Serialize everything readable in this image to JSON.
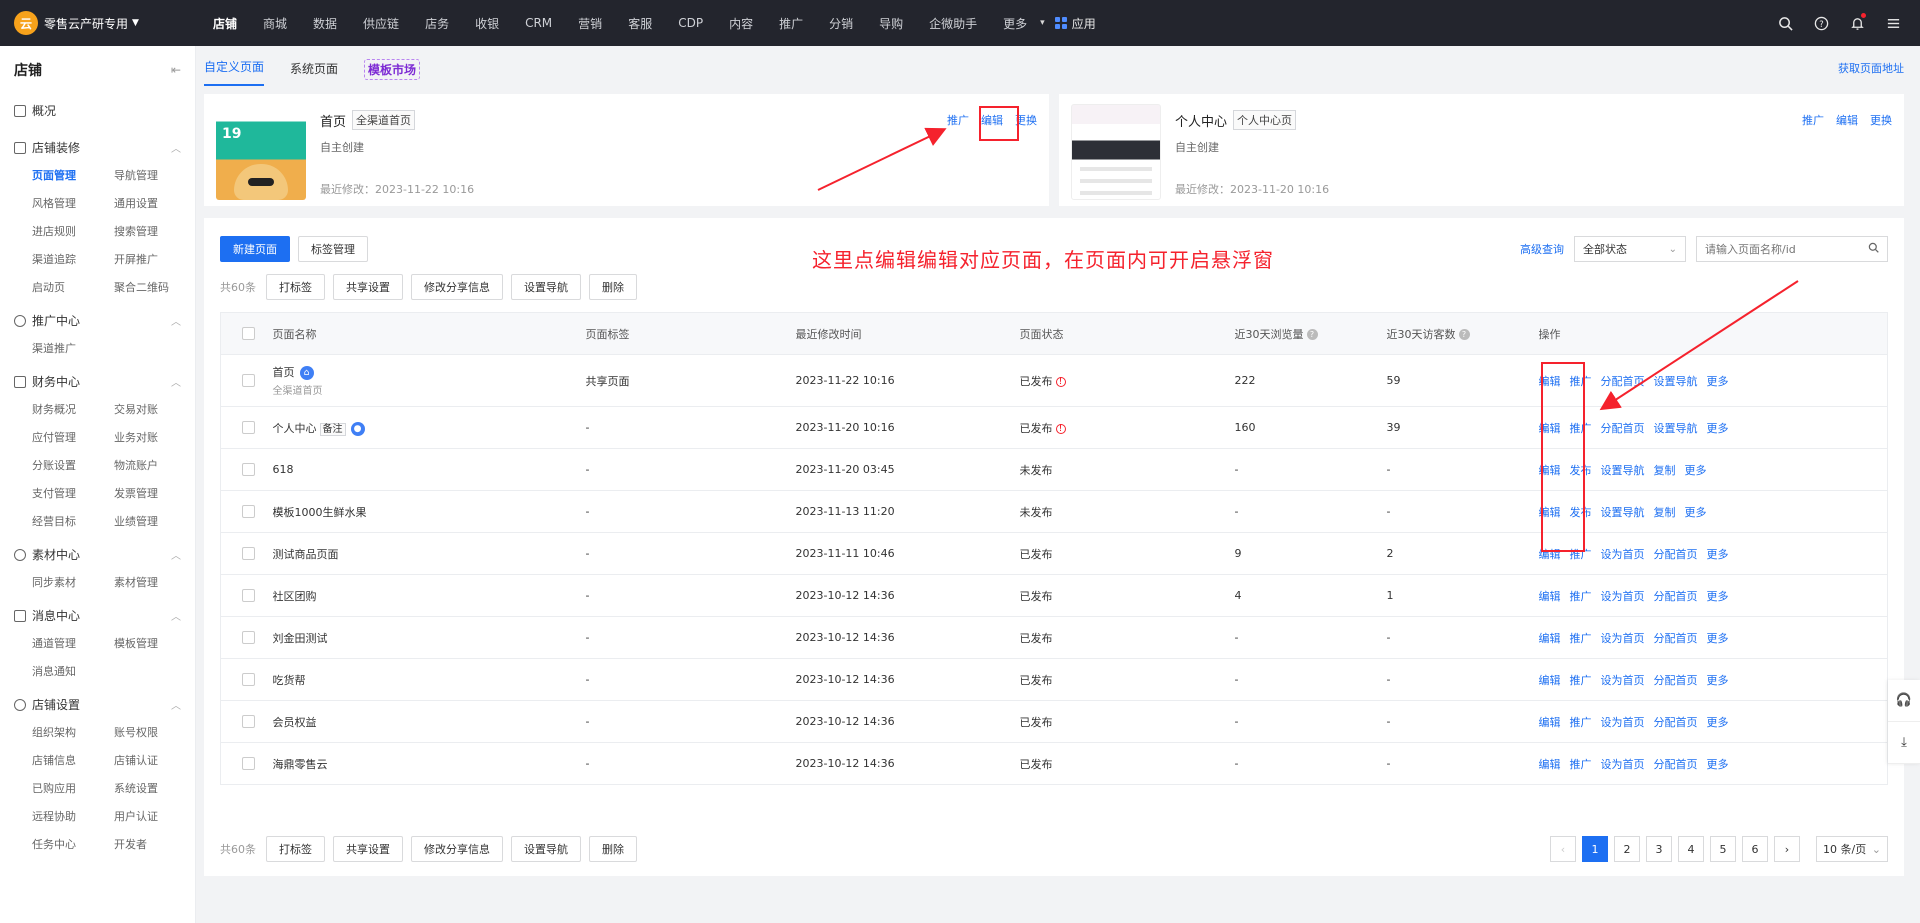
{
  "brand": {
    "name": "零售云产研专用"
  },
  "nav": {
    "items": [
      "店铺",
      "商城",
      "数据",
      "供应链",
      "店务",
      "收银",
      "CRM",
      "营销",
      "客服",
      "CDP",
      "内容",
      "推广",
      "分销",
      "导购",
      "企微助手",
      "更多"
    ],
    "app_label": "应用"
  },
  "sidebar": {
    "title": "店铺",
    "overview": "概况",
    "groups": [
      {
        "title": "店铺装修",
        "items": [
          "页面管理",
          "导航管理",
          "风格管理",
          "通用设置",
          "进店规则",
          "搜索管理",
          "渠道追踪",
          "开屏推广",
          "启动页",
          "聚合二维码"
        ]
      },
      {
        "title": "推广中心",
        "items": [
          "渠道推广"
        ]
      },
      {
        "title": "财务中心",
        "items": [
          "财务概况",
          "交易对账",
          "应付管理",
          "业务对账",
          "分账设置",
          "物流账户",
          "支付管理",
          "发票管理",
          "经营目标",
          "业绩管理"
        ]
      },
      {
        "title": "素材中心",
        "items": [
          "同步素材",
          "素材管理"
        ]
      },
      {
        "title": "消息中心",
        "items": [
          "通道管理",
          "模板管理",
          "消息通知"
        ]
      },
      {
        "title": "店铺设置",
        "items": [
          "组织架构",
          "账号权限",
          "店铺信息",
          "店铺认证",
          "已购应用",
          "系统设置",
          "远程协助",
          "用户认证",
          "任务中心",
          "开发者"
        ]
      }
    ]
  },
  "tabs": {
    "custom": "自定义页面",
    "system": "系统页面",
    "market": "模板市场",
    "get_url": "获取页面地址"
  },
  "cards": [
    {
      "title": "首页",
      "tag": "全渠道首页",
      "sub": "自主创建",
      "meta": "最近修改：2023-11-22 10:16",
      "actions": [
        "推广",
        "编辑",
        "更换"
      ]
    },
    {
      "title": "个人中心",
      "tag": "个人中心页",
      "sub": "自主创建",
      "meta": "最近修改：2023-11-20 10:16",
      "actions": [
        "推广",
        "编辑",
        "更换"
      ]
    }
  ],
  "toolbar": {
    "new_page": "新建页面",
    "tag_manage": "标签管理",
    "annotation": "这里点编辑编辑对应页面，在页面内可开启悬浮窗",
    "advanced": "高级查询",
    "status_select": "全部状态",
    "search_placeholder": "请输入页面名称/id"
  },
  "batch": {
    "count": "共60条",
    "buttons": [
      "打标签",
      "共享设置",
      "修改分享信息",
      "设置导航",
      "删除"
    ]
  },
  "table": {
    "headers": [
      "页面名称",
      "页面标签",
      "最近修改时间",
      "页面状态",
      "近30天浏览量",
      "近30天访客数",
      "操作"
    ],
    "rows": [
      {
        "name": "首页",
        "sub": "全渠道首页",
        "tag": "共享页面",
        "time": "2023-11-22 10:16",
        "status": "已发布",
        "pv": "222",
        "uv": "59",
        "ops": [
          "编辑",
          "推广",
          "分配首页",
          "设置导航",
          "更多"
        ]
      },
      {
        "name": "个人中心",
        "name_tag": "备注",
        "tag": "-",
        "time": "2023-11-20 10:16",
        "status": "已发布",
        "pv": "160",
        "uv": "39",
        "ops": [
          "编辑",
          "推广",
          "分配首页",
          "设置导航",
          "更多"
        ]
      },
      {
        "name": "618",
        "tag": "-",
        "time": "2023-11-20 03:45",
        "status": "未发布",
        "pv": "-",
        "uv": "-",
        "ops": [
          "编辑",
          "发布",
          "设置导航",
          "复制",
          "更多"
        ]
      },
      {
        "name": "模板1000生鲜水果",
        "tag": "-",
        "time": "2023-11-13 11:20",
        "status": "未发布",
        "pv": "-",
        "uv": "-",
        "ops": [
          "编辑",
          "发布",
          "设置导航",
          "复制",
          "更多"
        ]
      },
      {
        "name": "测试商品页面",
        "tag": "-",
        "time": "2023-11-11 10:46",
        "status": "已发布",
        "pv": "9",
        "uv": "2",
        "ops": [
          "编辑",
          "推广",
          "设为首页",
          "分配首页",
          "更多"
        ]
      },
      {
        "name": "社区团购",
        "tag": "-",
        "time": "2023-10-12 14:36",
        "status": "已发布",
        "pv": "4",
        "uv": "1",
        "ops": [
          "编辑",
          "推广",
          "设为首页",
          "分配首页",
          "更多"
        ]
      },
      {
        "name": "刘金田测试",
        "tag": "-",
        "time": "2023-10-12 14:36",
        "status": "已发布",
        "pv": "-",
        "uv": "-",
        "ops": [
          "编辑",
          "推广",
          "设为首页",
          "分配首页",
          "更多"
        ]
      },
      {
        "name": "吃货帮",
        "tag": "-",
        "time": "2023-10-12 14:36",
        "status": "已发布",
        "pv": "-",
        "uv": "-",
        "ops": [
          "编辑",
          "推广",
          "设为首页",
          "分配首页",
          "更多"
        ]
      },
      {
        "name": "会员权益",
        "tag": "-",
        "time": "2023-10-12 14:36",
        "status": "已发布",
        "pv": "-",
        "uv": "-",
        "ops": [
          "编辑",
          "推广",
          "设为首页",
          "分配首页",
          "更多"
        ]
      },
      {
        "name": "海鼎零售云",
        "tag": "-",
        "time": "2023-10-12 14:36",
        "status": "已发布",
        "pv": "-",
        "uv": "-",
        "ops": [
          "编辑",
          "推广",
          "设为首页",
          "分配首页",
          "更多"
        ]
      }
    ]
  },
  "pager": {
    "pages": [
      "1",
      "2",
      "3",
      "4",
      "5",
      "6"
    ],
    "current": "1",
    "per_page": "10 条/页"
  },
  "colors": {
    "primary": "#1d6ff2",
    "topbar": "#23252d",
    "annotation": "#f5222d"
  }
}
